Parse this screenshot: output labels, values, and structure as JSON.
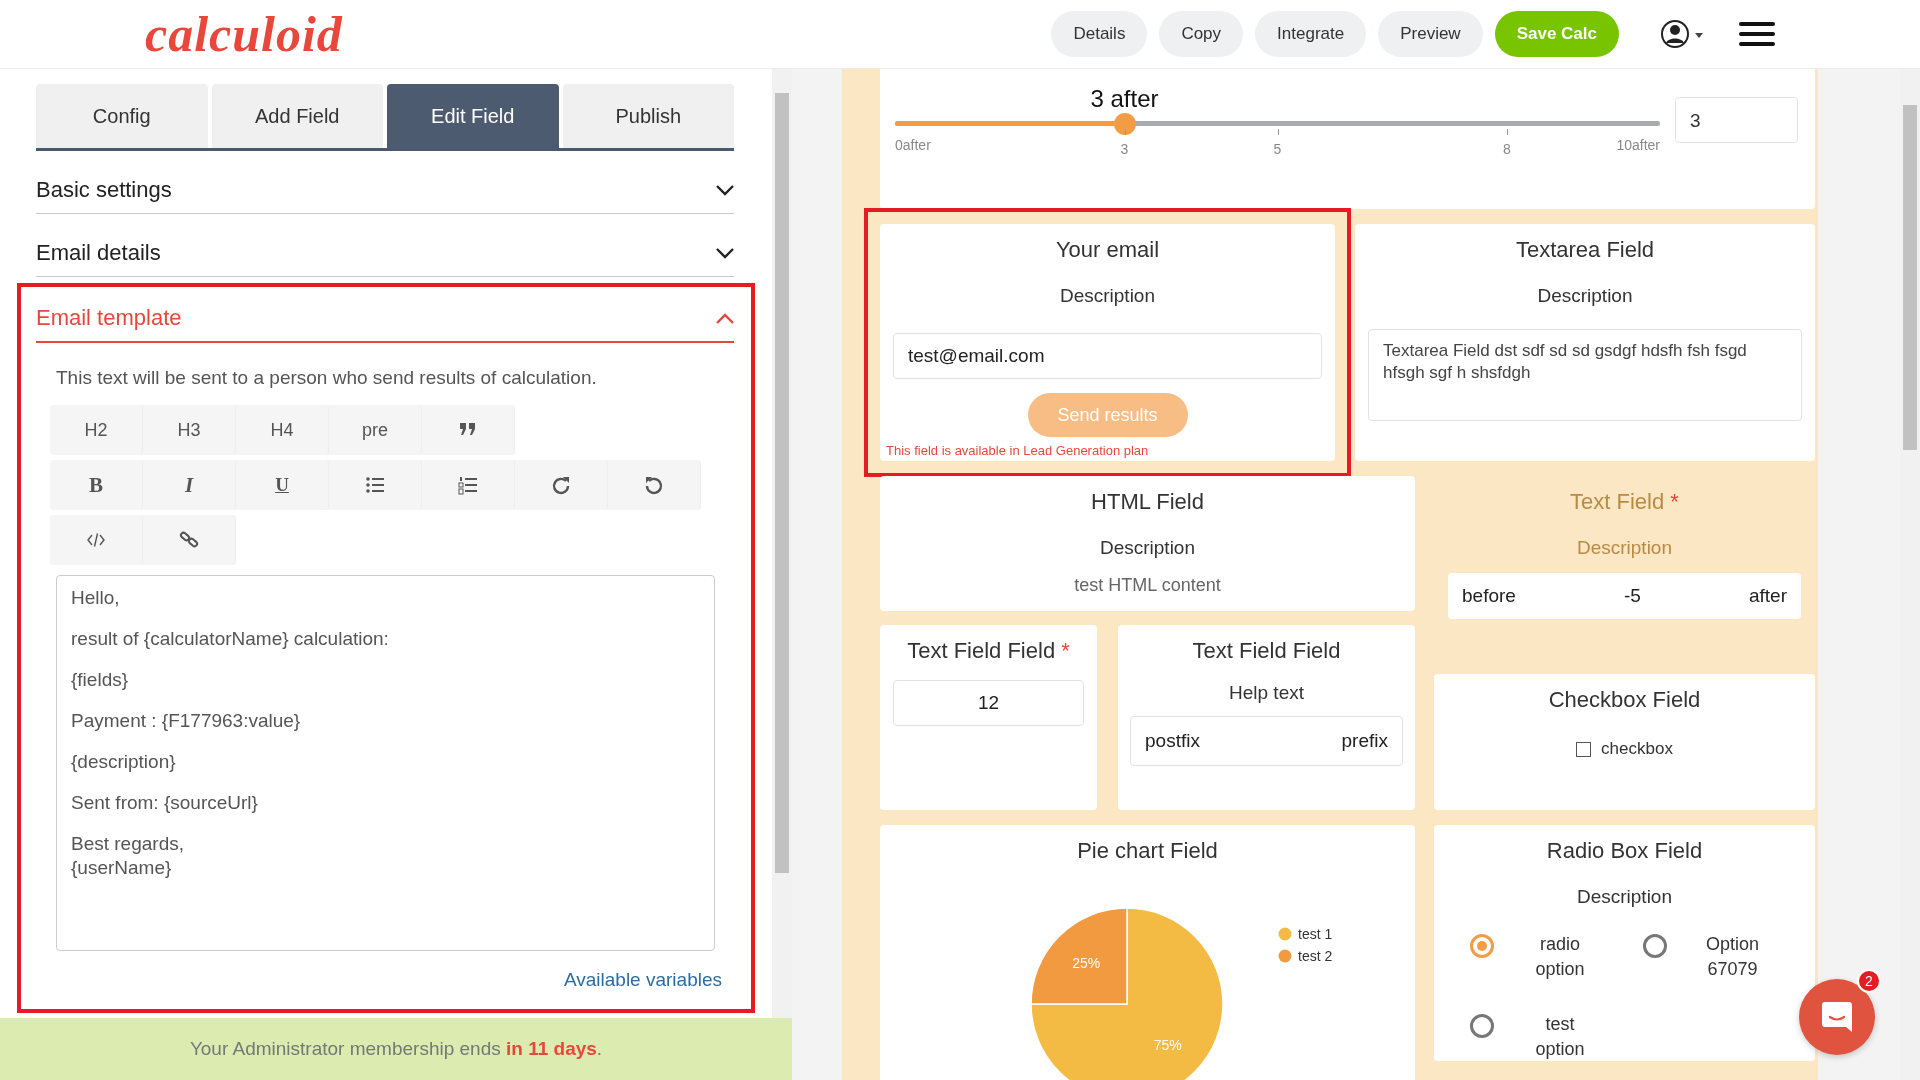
{
  "header": {
    "logo": "calculoid",
    "actions": [
      {
        "label": "Details",
        "kind": "secondary"
      },
      {
        "label": "Copy",
        "kind": "secondary"
      },
      {
        "label": "Integrate",
        "kind": "secondary"
      },
      {
        "label": "Preview",
        "kind": "secondary"
      },
      {
        "label": "Save Calc",
        "kind": "primary"
      }
    ]
  },
  "sidebar": {
    "tabs": [
      {
        "label": "Config",
        "selected": false
      },
      {
        "label": "Add Field",
        "selected": false
      },
      {
        "label": "Edit Field",
        "selected": true
      },
      {
        "label": "Publish",
        "selected": false
      }
    ],
    "sections": [
      {
        "title": "Basic settings",
        "expanded": false,
        "highlighted": false
      },
      {
        "title": "Email details",
        "expanded": false,
        "highlighted": false
      },
      {
        "title": "Email template",
        "expanded": true,
        "highlighted": true
      }
    ],
    "email_template": {
      "hint": "This text will be sent to a person who send results of calculation.",
      "toolbar": [
        [
          {
            "kind": "text",
            "label": "H2"
          },
          {
            "kind": "text",
            "label": "H3"
          },
          {
            "kind": "text",
            "label": "H4"
          },
          {
            "kind": "text",
            "label": "pre"
          },
          {
            "kind": "quote"
          }
        ],
        [
          {
            "kind": "bold",
            "label": "B"
          },
          {
            "kind": "italic",
            "label": "I"
          },
          {
            "kind": "underline",
            "label": "U"
          },
          {
            "kind": "bullet-list"
          },
          {
            "kind": "numbered-list"
          },
          {
            "kind": "redo"
          },
          {
            "kind": "undo"
          }
        ],
        [
          {
            "kind": "code"
          },
          {
            "kind": "link"
          }
        ]
      ],
      "body": [
        "Hello,",
        "result of {calculatorName} calculation:",
        "{fields}",
        "Payment : {F177963:value}",
        "{description}",
        "Sent from: {sourceUrl}",
        "Best regards,\n{userName}"
      ],
      "link": "Available variables"
    },
    "footer": "Your Administrator membership ends **in 11 days**."
  },
  "preview": {
    "slider": {
      "value_label": "3 after",
      "level": 0.3,
      "ticks": [
        "0after",
        "3",
        "5",
        "8",
        "10after"
      ],
      "input_value": "3"
    },
    "email_field": {
      "title": "Your email",
      "description": "Description",
      "value": "test@email.com",
      "button": "Send results",
      "note": "This field is available in Lead Generation plan",
      "highlighted": true
    },
    "textarea_field": {
      "title": "Textarea Field",
      "description": "Description",
      "value": "Textarea Field dst sdf sd sd gsdgf hdsfh fsh fsgd hfsgh sgf h shsfdgh"
    },
    "html_field": {
      "title": "HTML Field",
      "description": "Description",
      "content": "test HTML content"
    },
    "text_field": {
      "title": "Text Field",
      "required": true,
      "required_mark": "*",
      "hidden": true,
      "description": "Description",
      "prefix": "before",
      "value": "-5",
      "suffix": "after"
    },
    "number_field": {
      "title": "Text Field Field",
      "required": true,
      "required_mark": "*",
      "value": "12"
    },
    "affix_field": {
      "title": "Text Field Field",
      "help": "Help text",
      "left": "postfix",
      "right": "prefix"
    },
    "checkbox_field": {
      "title": "Checkbox Field",
      "options": [
        {
          "label": "checkbox",
          "checked": false
        }
      ]
    },
    "pie_chart_field": {
      "title": "Pie chart Field",
      "chart_data": {
        "type": "pie",
        "categories": [
          "test 1",
          "test 2"
        ],
        "values": [
          75,
          25
        ],
        "legend": "right",
        "value_labels": [
          "75%",
          "25%"
        ]
      }
    },
    "radio_field": {
      "title": "Radio Box Field",
      "description": "Description",
      "options": [
        {
          "label": "radio option",
          "selected": true
        },
        {
          "label": "Option 67079",
          "selected": false
        },
        {
          "label": "test option",
          "selected": false
        }
      ]
    }
  },
  "chat": {
    "badge": "2"
  }
}
